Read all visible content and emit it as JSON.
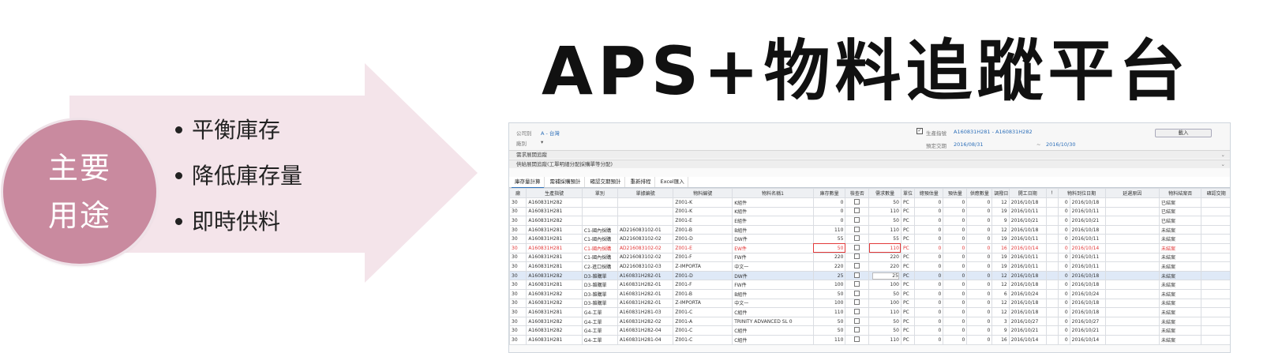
{
  "slide": {
    "title": "APS+物料追蹤平台",
    "circle_line1": "主要",
    "circle_line2": "用途",
    "bullets": [
      "平衡庫存",
      "降低庫存量",
      "即時供料"
    ],
    "colors": {
      "arrow": "#f4e4ea",
      "circle": "#c98a9f"
    }
  },
  "app": {
    "filter": {
      "company_label": "公司別",
      "company_value": "A - 台灣",
      "type_label": "廠別",
      "type_value": "▾",
      "order_label": "生產指號",
      "order_value": "A160831H281 - A160831H282",
      "date_label": "預定交期",
      "date_from": "2016/08/31",
      "date_sep": "~",
      "date_to": "2016/10/30",
      "import_button": "載入"
    },
    "group_rows": [
      "需求展開追蹤",
      "供給展開追蹤(工單明細分配採購單等分配)"
    ],
    "tabs": [
      "庫存量計算",
      "需補採購預計",
      "確認交期預計",
      "重新排程",
      "Excel匯入"
    ],
    "columns": [
      "廠",
      "生產指號",
      "單別",
      "單據編號",
      "物料編號",
      "物料名稱1",
      "庫存數量",
      "檢查否",
      "需求數量",
      "單位",
      "總預估量",
      "預估量",
      "供應數量",
      "調撥日",
      "開工日期",
      "!",
      "物料到位日期",
      "延遲原因",
      "物料結案否",
      "確認交期"
    ],
    "rows": [
      [
        "30",
        "A160831H282",
        "",
        "",
        "Z001-K",
        "K組件",
        "0",
        "",
        "50",
        "PC",
        "0",
        "0",
        "0",
        "12",
        "2016/10/18",
        "",
        "0",
        "2016/10/18",
        "",
        "已結案",
        ""
      ],
      [
        "30",
        "A160831H281",
        "",
        "",
        "Z001-K",
        "K組件",
        "0",
        "",
        "110",
        "PC",
        "0",
        "0",
        "0",
        "19",
        "2016/10/11",
        "",
        "0",
        "2016/10/11",
        "",
        "已結案",
        ""
      ],
      [
        "30",
        "A160831H282",
        "",
        "",
        "Z001-E",
        "E組件",
        "0",
        "",
        "50",
        "PC",
        "0",
        "0",
        "0",
        "9",
        "2016/10/21",
        "",
        "0",
        "2016/10/21",
        "",
        "已結案",
        ""
      ],
      [
        "30",
        "A160831H281",
        "C1-國內採購",
        "AD216083102-01",
        "Z001-B",
        "B組件",
        "110",
        "",
        "110",
        "PC",
        "0",
        "0",
        "0",
        "12",
        "2016/10/18",
        "",
        "0",
        "2016/10/18",
        "",
        "未結案",
        ""
      ],
      [
        "30",
        "A160831H281",
        "C1-國內採購",
        "AD216083102-02",
        "Z001-D",
        "DW件",
        "55",
        "",
        "55",
        "PC",
        "0",
        "0",
        "0",
        "19",
        "2016/10/11",
        "",
        "0",
        "2016/10/11",
        "",
        "未結案",
        ""
      ],
      [
        "30",
        "A160831H281",
        "C1-國內採購",
        "AD216083102-02",
        "Z001-E",
        "EW件",
        "50",
        "",
        "110",
        "PC",
        "0",
        "0",
        "0",
        "16",
        "2016/10/14",
        "",
        "0",
        "2016/10/14",
        "",
        "未結案",
        ""
      ],
      [
        "30",
        "A160831H281",
        "C1-國內採購",
        "AD216083102-02",
        "Z001-F",
        "FW件",
        "220",
        "",
        "220",
        "PC",
        "0",
        "0",
        "0",
        "19",
        "2016/10/11",
        "",
        "0",
        "2016/10/11",
        "",
        "未結案",
        ""
      ],
      [
        "30",
        "A160831H281",
        "C2-進口採購",
        "AD216083102-03",
        "Z-IMPORTA",
        "中文一",
        "220",
        "",
        "220",
        "PC",
        "0",
        "0",
        "0",
        "19",
        "2016/10/11",
        "",
        "0",
        "2016/10/11",
        "",
        "未結案",
        ""
      ],
      [
        "30",
        "A160831H282",
        "D3-雜購單",
        "A160831H282-01",
        "Z001-D",
        "DW件",
        "25",
        "",
        "25",
        "PC",
        "0",
        "0",
        "0",
        "12",
        "2016/10/18",
        "",
        "0",
        "2016/10/18",
        "",
        "未結案",
        ""
      ],
      [
        "30",
        "A160831H281",
        "D3-雜購單",
        "A160831H282-01",
        "Z001-F",
        "FW件",
        "100",
        "",
        "100",
        "PC",
        "0",
        "0",
        "0",
        "12",
        "2016/10/18",
        "",
        "0",
        "2016/10/18",
        "",
        "未結案",
        ""
      ],
      [
        "30",
        "A160831H282",
        "D3-雜購單",
        "A160831H282-01",
        "Z001-B",
        "B組件",
        "50",
        "",
        "50",
        "PC",
        "0",
        "0",
        "0",
        "6",
        "2016/10/24",
        "",
        "0",
        "2016/10/24",
        "",
        "未結案",
        ""
      ],
      [
        "30",
        "A160831H282",
        "D3-雜購單",
        "A160831H282-01",
        "Z-IMPORTA",
        "中文一",
        "100",
        "",
        "100",
        "PC",
        "0",
        "0",
        "0",
        "12",
        "2016/10/18",
        "",
        "0",
        "2016/10/18",
        "",
        "未結案",
        ""
      ],
      [
        "30",
        "A160831H281",
        "G4-工單",
        "A160831H281-03",
        "Z001-C",
        "C組件",
        "110",
        "",
        "110",
        "PC",
        "0",
        "0",
        "0",
        "12",
        "2016/10/18",
        "",
        "0",
        "2016/10/18",
        "",
        "未結案",
        ""
      ],
      [
        "30",
        "A160831H282",
        "G4-工單",
        "A160831H282-02",
        "Z001-A",
        "TRINITY ADVANCED SL 0",
        "50",
        "",
        "50",
        "PC",
        "0",
        "0",
        "0",
        "3",
        "2016/10/27",
        "",
        "0",
        "2016/10/27",
        "",
        "未結案",
        ""
      ],
      [
        "30",
        "A160831H282",
        "G4-工單",
        "A160831H282-04",
        "Z001-C",
        "C組件",
        "50",
        "",
        "50",
        "PC",
        "0",
        "0",
        "0",
        "9",
        "2016/10/21",
        "",
        "0",
        "2016/10/21",
        "",
        "未結案",
        ""
      ],
      [
        "30",
        "A160831H281",
        "G4-工單",
        "A160831H281-04",
        "Z001-C",
        "C組件",
        "110",
        "",
        "110",
        "PC",
        "0",
        "0",
        "0",
        "16",
        "2016/10/14",
        "",
        "0",
        "2016/10/14",
        "",
        "未結案",
        ""
      ]
    ],
    "highlight_row": 5,
    "selected_row": 8
  }
}
